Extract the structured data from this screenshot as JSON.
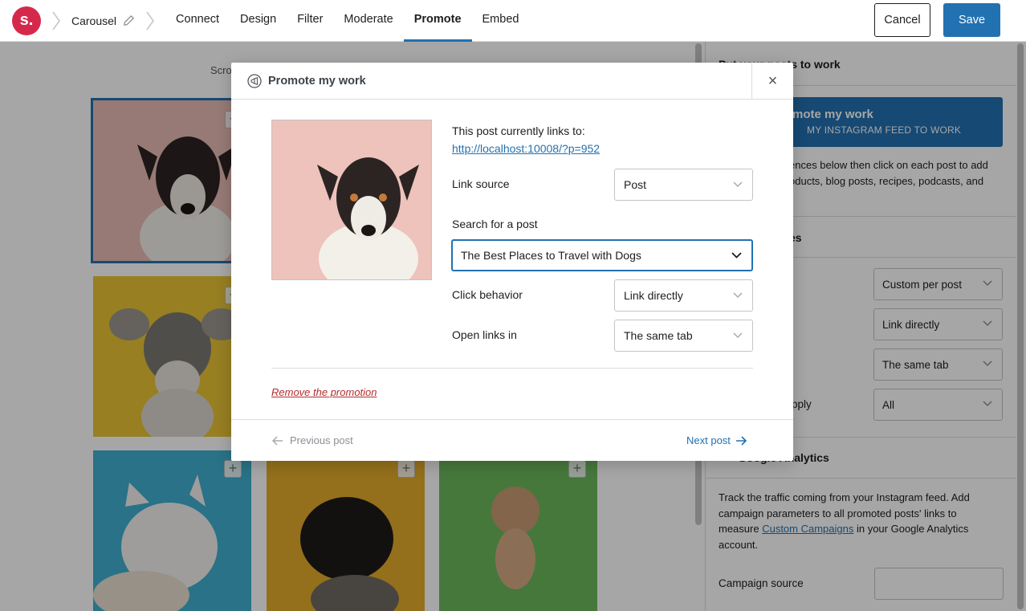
{
  "header": {
    "logo_text": "s.",
    "breadcrumb": "Carousel",
    "tabs": [
      {
        "label": "Connect"
      },
      {
        "label": "Design"
      },
      {
        "label": "Filter"
      },
      {
        "label": "Moderate"
      },
      {
        "label": "Promote"
      },
      {
        "label": "Embed"
      }
    ],
    "active_tab": "Promote",
    "cancel_label": "Cancel",
    "save_label": "Save"
  },
  "grid": {
    "scroll_text": "Scro"
  },
  "sidebar": {
    "section1_title": "Put your posts to work",
    "banner_title": "mote my work",
    "banner_sub": "MY INSTAGRAM FEED TO WORK",
    "intro_line1": "ences below then click on each post to add",
    "intro_line2": "oducts, blog posts, recipes, podcasts, and",
    "section2_title": "es",
    "selects": [
      {
        "value": "Custom per post"
      },
      {
        "value": "Link directly"
      },
      {
        "value": "The same tab"
      },
      {
        "value": "All"
      }
    ],
    "apply_label": "pply",
    "section3_title": "Google Analytics",
    "ga_text1": "Track the traffic coming from your Instagram feed. Add",
    "ga_text2": "campaign parameters to all promoted posts' links to",
    "ga_text3_pre": "measure ",
    "ga_link": "Custom Campaigns",
    "ga_text3_post": " in your Google Analytics",
    "ga_text4": "account.",
    "campaign_source_label": "Campaign source"
  },
  "modal": {
    "title": "Promote my work",
    "close": "×",
    "currently_links_label": "This post currently links to:",
    "current_link": "http://localhost:10008/?p=952",
    "link_source_label": "Link source",
    "link_source_value": "Post",
    "search_label": "Search for a post",
    "search_value": "The Best Places to Travel with Dogs",
    "click_behavior_label": "Click behavior",
    "click_behavior_value": "Link directly",
    "open_links_label": "Open links in",
    "open_links_value": "The same tab",
    "remove_label": "Remove the promotion",
    "prev_label": "Previous post",
    "next_label": "Next post"
  },
  "colors": {
    "accent": "#2271b1",
    "brand": "#d5294b",
    "danger": "#b32d2e"
  }
}
